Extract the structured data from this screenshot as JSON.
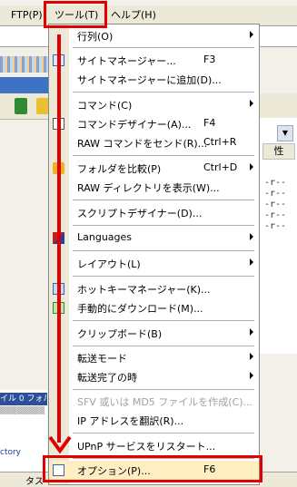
{
  "menubar": {
    "items": [
      {
        "label": "FTP(P)"
      },
      {
        "label": "ツール(T)"
      },
      {
        "label": "ヘルプ(H)"
      }
    ]
  },
  "background": {
    "column_attr": "性",
    "permissions": [
      "-r--",
      "-r--",
      "-r--",
      "-r--",
      "-r--"
    ],
    "log_line1": "イル 0 フォル",
    "log_line2": "ctory",
    "task_label": "タス"
  },
  "menu": {
    "items": [
      {
        "label": "行列(O)",
        "submenu": true
      },
      {
        "label": "サイトマネージャー...",
        "shortcut": "F3",
        "icon": "site-manager-icon"
      },
      {
        "label": "サイトマネージャーに追加(D)..."
      },
      {
        "label": "コマンド(C)",
        "submenu": true
      },
      {
        "label": "コマンドデザイナー(A)...",
        "shortcut": "F4",
        "icon": "command-designer-icon"
      },
      {
        "label": "RAW コマンドをセンド(R)...",
        "shortcut": "Ctrl+R"
      },
      {
        "label": "フォルダを比較(P)",
        "shortcut": "Ctrl+D",
        "submenu": true,
        "icon": "compare-folder-icon"
      },
      {
        "label": "RAW ディレクトリを表示(W)..."
      },
      {
        "label": "スクリプトデザイナー(D)..."
      },
      {
        "label": "Languages",
        "submenu": true,
        "icon": "flag-icon"
      },
      {
        "label": "レイアウト(L)",
        "submenu": true
      },
      {
        "label": "ホットキーマネージャー(K)...",
        "icon": "hotkey-icon"
      },
      {
        "label": "手動的にダウンロード(M)...",
        "icon": "download-icon"
      },
      {
        "label": "クリップボード(B)",
        "submenu": true
      },
      {
        "label": "転送モード",
        "submenu": true
      },
      {
        "label": "転送完了の時",
        "submenu": true
      },
      {
        "label": "SFV 或いは MD5 ファイルを作成(C)...",
        "disabled": true
      },
      {
        "label": "IP アドレスを翻訳(R)..."
      },
      {
        "label": "UPnP サービスをリスタート..."
      },
      {
        "label": "オプション(P)...",
        "shortcut": "F6",
        "icon": "options-icon",
        "highlighted": true
      }
    ]
  },
  "colors": {
    "highlight": "#e00000",
    "menu_gutter": "#ece9d8",
    "selection": "#ffeec2"
  }
}
